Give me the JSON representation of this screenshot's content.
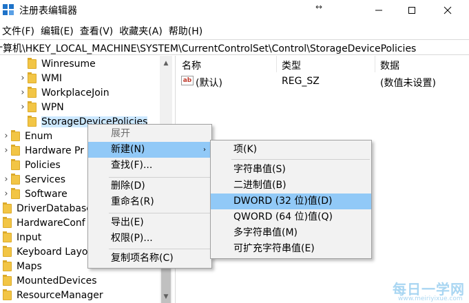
{
  "window": {
    "title": "注册表编辑器",
    "resize_glyph": "↔"
  },
  "menu": [
    "文件(F)",
    "编辑(E)",
    "查看(V)",
    "收藏夹(A)",
    "帮助(H)"
  ],
  "address": "计算机\\HKEY_LOCAL_MACHINE\\SYSTEM\\CurrentControlSet\\Control\\StorageDevicePolicies",
  "tree": {
    "items": [
      {
        "label": "Winresume",
        "expander": ""
      },
      {
        "label": "WMI",
        "expander": "›"
      },
      {
        "label": "WorkplaceJoin",
        "expander": "›"
      },
      {
        "label": "WPN",
        "expander": "›"
      },
      {
        "label": "StorageDevicePolicies",
        "expander": "",
        "selected": true
      },
      {
        "label": "Enum",
        "expander": "›"
      },
      {
        "label": "Hardware Pr",
        "expander": "›"
      },
      {
        "label": "Policies",
        "expander": ""
      },
      {
        "label": "Services",
        "expander": "›"
      },
      {
        "label": "Software",
        "expander": "›"
      },
      {
        "label": "DriverDatabase",
        "expander": ""
      },
      {
        "label": "HardwareConf",
        "expander": ""
      },
      {
        "label": "Input",
        "expander": ""
      },
      {
        "label": "Keyboard Layo",
        "expander": ""
      },
      {
        "label": "Maps",
        "expander": ""
      },
      {
        "label": "MountedDevices",
        "expander": ""
      },
      {
        "label": "ResourceManager",
        "expander": ""
      }
    ]
  },
  "list": {
    "columns": [
      "名称",
      "类型",
      "数据"
    ],
    "rows": [
      {
        "icon": "ab",
        "name": "(默认)",
        "type": "REG_SZ",
        "data": "(数值未设置)"
      }
    ]
  },
  "context_menu": {
    "items": [
      {
        "label": "展开",
        "disabled": true
      },
      {
        "label": "新建(N)",
        "highlighted": true,
        "submenu_arrow": "›"
      },
      {
        "label": "查找(F)..."
      },
      {
        "label": "删除(D)"
      },
      {
        "label": "重命名(R)"
      },
      {
        "label": "导出(E)"
      },
      {
        "label": "权限(P)..."
      },
      {
        "label": "复制项名称(C)"
      }
    ]
  },
  "submenu": {
    "items": [
      {
        "label": "项(K)"
      },
      {
        "label": "字符串值(S)"
      },
      {
        "label": "二进制值(B)"
      },
      {
        "label": "DWORD (32 位)值(D)",
        "highlighted": true
      },
      {
        "label": "QWORD (64 位)值(Q)"
      },
      {
        "label": "多字符串值(M)"
      },
      {
        "label": "可扩充字符串值(E)"
      }
    ]
  },
  "watermark": {
    "main": "每日一学网",
    "sub": "www.meiriyixue.com"
  },
  "colors": {
    "selection": "#cce8ff",
    "menu_highlight": "#91c9f7",
    "folder": "#f2c545"
  }
}
